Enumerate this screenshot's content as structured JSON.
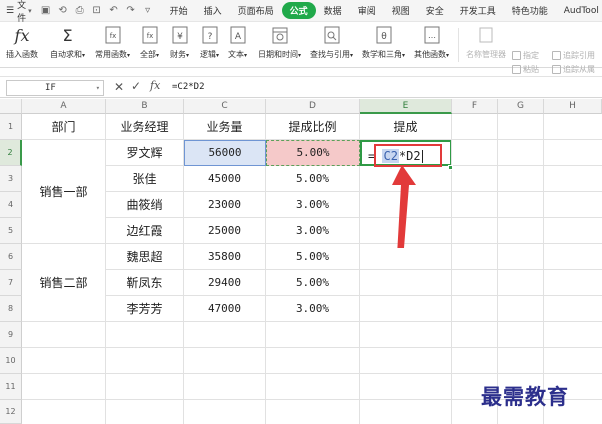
{
  "menubar": {
    "file_label": "文件",
    "tabs": [
      "开始",
      "插入",
      "页面布局",
      "公式",
      "数据",
      "审阅",
      "视图",
      "安全",
      "开发工具",
      "特色功能",
      "AudTool"
    ],
    "active_tab": "公式"
  },
  "ribbon": {
    "insert_function": "插入函数",
    "autosum": "自动求和",
    "recent": "常用函数",
    "all": "全部",
    "financial": "财务",
    "logical": "逻辑",
    "text": "文本",
    "datetime": "日期和时间",
    "lookup": "查找与引用",
    "math": "数学和三角",
    "other": "其他函数",
    "name_manager": "名称管理器",
    "specify": "指定",
    "paste": "粘贴",
    "trace_precedents": "追踪引用",
    "trace_dependents": "追踪从属"
  },
  "formula_bar": {
    "name_box": "IF",
    "cancel": "✕",
    "confirm": "✓",
    "fx": "fx",
    "formula": "=C2*D2"
  },
  "columns": [
    "A",
    "B",
    "C",
    "D",
    "E",
    "F",
    "G",
    "H"
  ],
  "rows": [
    "1",
    "2",
    "3",
    "4",
    "5",
    "6",
    "7",
    "8",
    "9",
    "10",
    "11",
    "12"
  ],
  "table": {
    "headers": [
      "部门",
      "业务经理",
      "业务量",
      "提成比例",
      "提成"
    ],
    "dept1": "销售一部",
    "dept2": "销售二部",
    "data": [
      {
        "manager": "罗文辉",
        "volume": "56000",
        "rate": "5.00%"
      },
      {
        "manager": "张佳",
        "volume": "45000",
        "rate": "5.00%"
      },
      {
        "manager": "曲筱绡",
        "volume": "23000",
        "rate": "3.00%"
      },
      {
        "manager": "边红霞",
        "volume": "25000",
        "rate": "3.00%"
      },
      {
        "manager": "魏思超",
        "volume": "35800",
        "rate": "5.00%"
      },
      {
        "manager": "靳凤东",
        "volume": "29400",
        "rate": "5.00%"
      },
      {
        "manager": "李芳芳",
        "volume": "47000",
        "rate": "3.00%"
      }
    ]
  },
  "editing": {
    "eq": "=",
    "c2": "C2",
    "op": "*",
    "d2": "D2"
  },
  "watermark": "最需教育",
  "colors": {
    "accent": "#20a94a",
    "c_ref": "#dbe5f5",
    "d_ref": "#f5c9c9",
    "highlight": "#e23a3a"
  }
}
